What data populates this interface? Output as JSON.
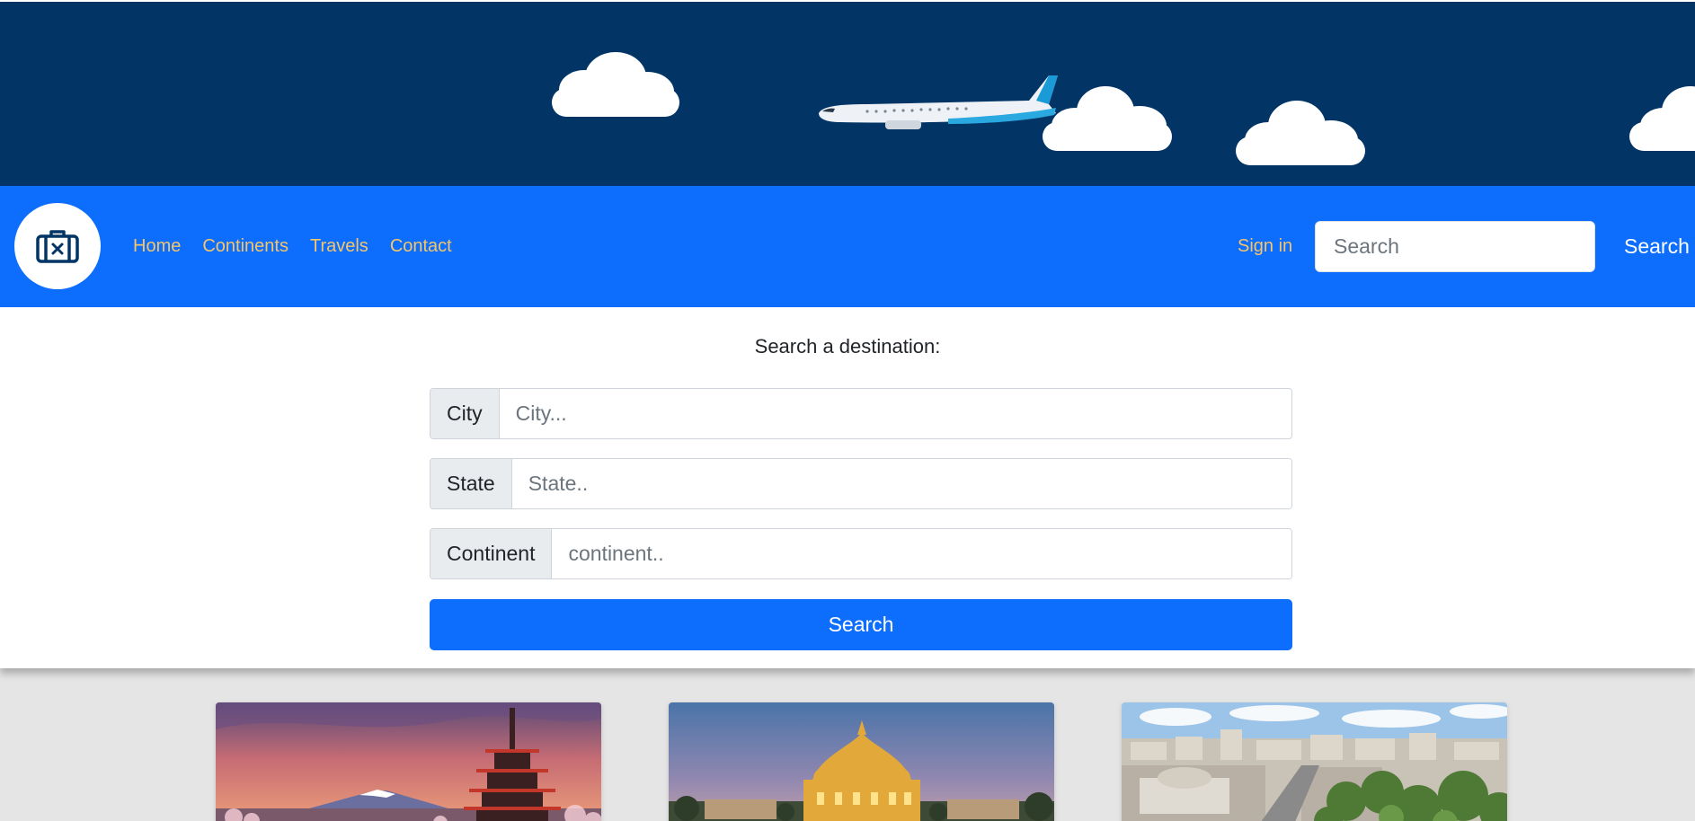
{
  "hero": {
    "icons": [
      "cloud-icon",
      "airplane-icon"
    ],
    "colors": {
      "background": "#023565"
    }
  },
  "navbar": {
    "logo_icon": "luggage-icon",
    "links": [
      {
        "label": "Home"
      },
      {
        "label": "Continents"
      },
      {
        "label": "Travels"
      },
      {
        "label": "Contact"
      }
    ],
    "sign_in_label": "Sign in",
    "search_placeholder": "Search",
    "search_button_label": "Search",
    "colors": {
      "background": "#0d6efd",
      "link": "#f5c568"
    }
  },
  "search_form": {
    "title": "Search a destination:",
    "fields": [
      {
        "label": "City",
        "placeholder": "City..."
      },
      {
        "label": "State",
        "placeholder": "State.."
      },
      {
        "label": "Continent",
        "placeholder": "continent.."
      }
    ],
    "submit_label": "Search"
  },
  "cards": [
    {
      "image": "japan-pagoda-mount-fuji-image"
    },
    {
      "image": "illuminated-temple-image"
    },
    {
      "image": "city-aerial-view-image"
    }
  ]
}
